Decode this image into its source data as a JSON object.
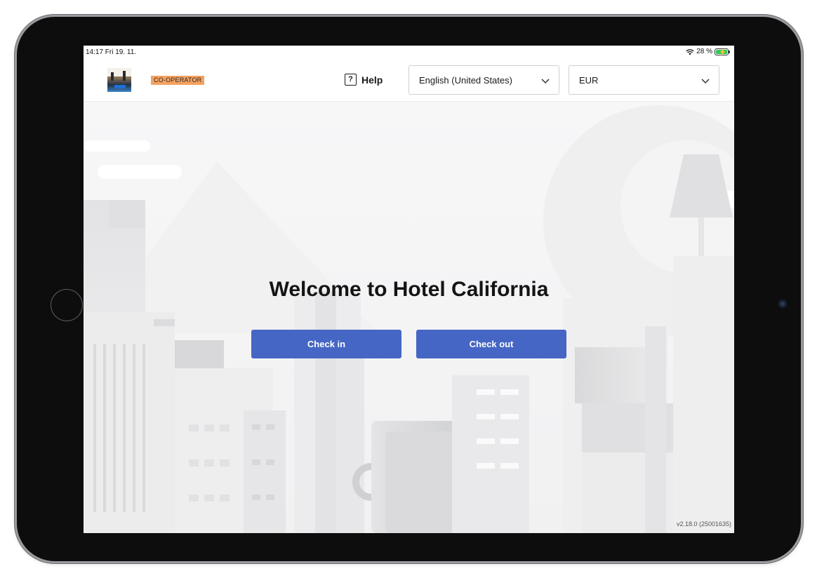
{
  "status_bar": {
    "time_date": "14:17  Fri 19. 11.",
    "battery": "28 %"
  },
  "header": {
    "role_badge": "CO-OPERATOR",
    "help_label": "Help",
    "language_select": {
      "value": "English (United States)"
    },
    "currency_select": {
      "value": "EUR"
    }
  },
  "main": {
    "welcome_title": "Welcome to Hotel California",
    "check_in_label": "Check in",
    "check_out_label": "Check out"
  },
  "footer": {
    "version": "v2.18.0 (25001635)"
  },
  "colors": {
    "primary_button": "#4566c4",
    "badge": "#f4a261"
  }
}
